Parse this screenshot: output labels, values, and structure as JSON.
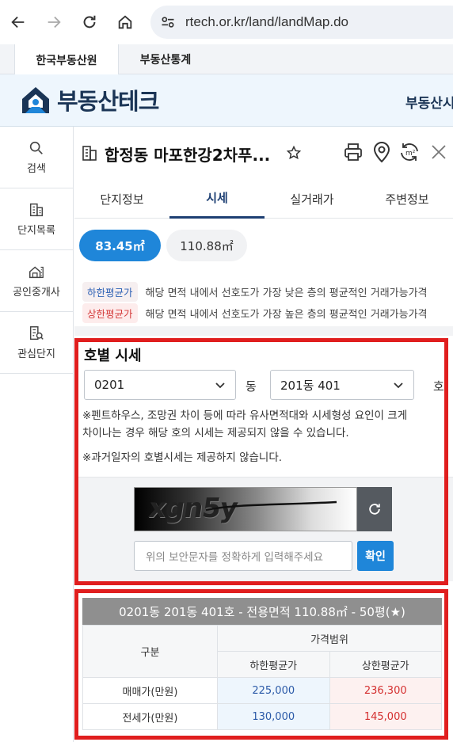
{
  "browser": {
    "url": "rtech.or.kr/land/landMap.do"
  },
  "site_tabs": [
    "한국부동산원",
    "부동산통계"
  ],
  "header": {
    "logo_text": "부동산테크",
    "right_text": "부동산시"
  },
  "sidebar": {
    "items": [
      {
        "label": "검색",
        "icon": "search-icon"
      },
      {
        "label": "단지목록",
        "icon": "building-list-icon"
      },
      {
        "label": "공인중개사",
        "icon": "agent-office-icon"
      },
      {
        "label": "관심단지",
        "icon": "favorite-complex-icon"
      }
    ]
  },
  "panel": {
    "title": "합정동 마포한강2차푸...",
    "tabs": [
      "단지정보",
      "시세",
      "실거래가",
      "주변정보"
    ],
    "active_tab": "시세",
    "area_chips": [
      "83.45㎡",
      "110.88㎡"
    ],
    "legend": [
      {
        "tag": "하한평균가",
        "desc": "해당 면적 내에서 선호도가 가장 낮은 층의 평균적인 거래가능가격"
      },
      {
        "tag": "상한평균가",
        "desc": "해당 면적 내에서 선호도가 가장 높은 층의 평균적인 거래가능가격"
      }
    ]
  },
  "unit_price": {
    "title": "호별 시세",
    "dong_select": "0201",
    "dong_unit": "동",
    "ho_select": "201동 401",
    "ho_unit": "호",
    "notice1_line1": "※펜트하우스, 조망권 차이 등에 따라 유사면적대와 시세형성 요인이 크게",
    "notice1_line2": "차이나는 경우 해당 호의 시세는 제공되지 않을 수 있습니다.",
    "notice2": "※과거일자의 호별시세는 제공하지 않습니다.",
    "captcha_text": "xgn5y",
    "captcha_placeholder": "위의 보안문자를 정확하게 입력해주세요",
    "confirm_label": "확인"
  },
  "result": {
    "heading": "0201동 201동 401호 - 전용면적 110.88㎡ - 50평(★)",
    "col_category": "구분",
    "col_range": "가격범위",
    "col_low": "하한평균가",
    "col_high": "상한평균가",
    "rows": [
      {
        "label": "매매가(만원)",
        "low": "225,000",
        "high": "236,300"
      },
      {
        "label": "전세가(만원)",
        "low": "130,000",
        "high": "145,000"
      }
    ]
  },
  "colors": {
    "accent": "#1f86d9",
    "brand": "#1b3556",
    "highlight_frame": "#e01e1e",
    "low_price": "#2b5aa8",
    "high_price": "#d42f2f"
  }
}
